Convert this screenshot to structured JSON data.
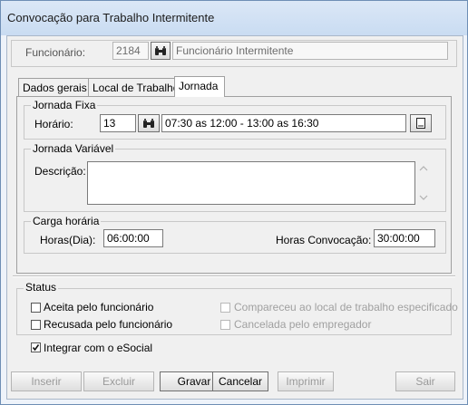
{
  "window": {
    "title": "Convocação para Trabalho Intermitente"
  },
  "employee": {
    "label": "Funcionário:",
    "code": "2184",
    "name": "Funcionário Intermitente"
  },
  "tabs": [
    {
      "label": "Dados gerais"
    },
    {
      "label": "Local de Trabalho"
    },
    {
      "label": "Jornada"
    }
  ],
  "jornada_fixa": {
    "title": "Jornada Fixa",
    "horario_label": "Horário:",
    "horario_code": "13",
    "horario_desc": "07:30 as 12:00 - 13:00 as 16:30"
  },
  "jornada_variavel": {
    "title": "Jornada Variável",
    "descricao_label": "Descrição:",
    "descricao_value": ""
  },
  "carga_horaria": {
    "title": "Carga horária",
    "horas_dia_label": "Horas(Dia):",
    "horas_dia_value": "06:00:00",
    "horas_convocacao_label": "Horas Convocação:",
    "horas_convocacao_value": "30:00:00"
  },
  "status": {
    "title": "Status",
    "aceita": {
      "label": "Aceita pelo funcionário",
      "checked": false
    },
    "recusada": {
      "label": "Recusada pelo funcionário",
      "checked": false
    },
    "compareceu": {
      "label": "Compareceu ao local de trabalho especificado",
      "checked": false,
      "disabled": true
    },
    "cancelada": {
      "label": "Cancelada pelo empregador",
      "checked": false,
      "disabled": true
    }
  },
  "esocial": {
    "label": "Integrar com o eSocial",
    "checked": true
  },
  "buttons": {
    "inserir": "Inserir",
    "excluir": "Excluir",
    "gravar": "Gravar",
    "cancelar": "Cancelar",
    "imprimir": "Imprimir",
    "sair": "Sair"
  },
  "icons": {
    "search": "binoculars-icon",
    "document": "document-icon",
    "scroll_up": "chevron-up-icon",
    "scroll_down": "chevron-down-icon",
    "check": "checkmark-icon"
  }
}
